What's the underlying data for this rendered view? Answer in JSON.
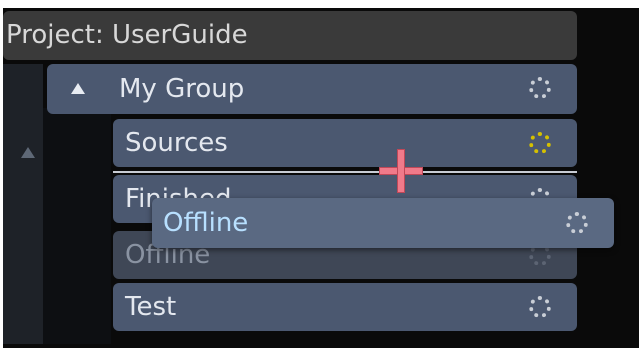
{
  "project": {
    "title": "Project: UserGuide"
  },
  "group": {
    "label": "My Group",
    "expand_icon": "triangle-up-icon",
    "status_icon": "sync-status-icon"
  },
  "items": [
    {
      "label": "Sources",
      "status_icon": "sync-status-icon",
      "status_color": "#d5c000"
    },
    {
      "label": "Finished",
      "status_icon": "sync-status-icon",
      "status_color": "#c9ced6"
    },
    {
      "label": "Offline",
      "status_icon": "sync-status-icon",
      "status_color": "#5c6473"
    },
    {
      "label": "Test",
      "status_icon": "sync-status-icon",
      "status_color": "#c9ced6"
    }
  ],
  "drag_ghost": {
    "label": "Offline",
    "status_icon": "sync-status-icon"
  },
  "colors": {
    "row_background": "#4b5870",
    "header_background": "#3a3a3a",
    "ghost_text": "#b8e0ff",
    "drop_cursor": "#f07a8a"
  }
}
